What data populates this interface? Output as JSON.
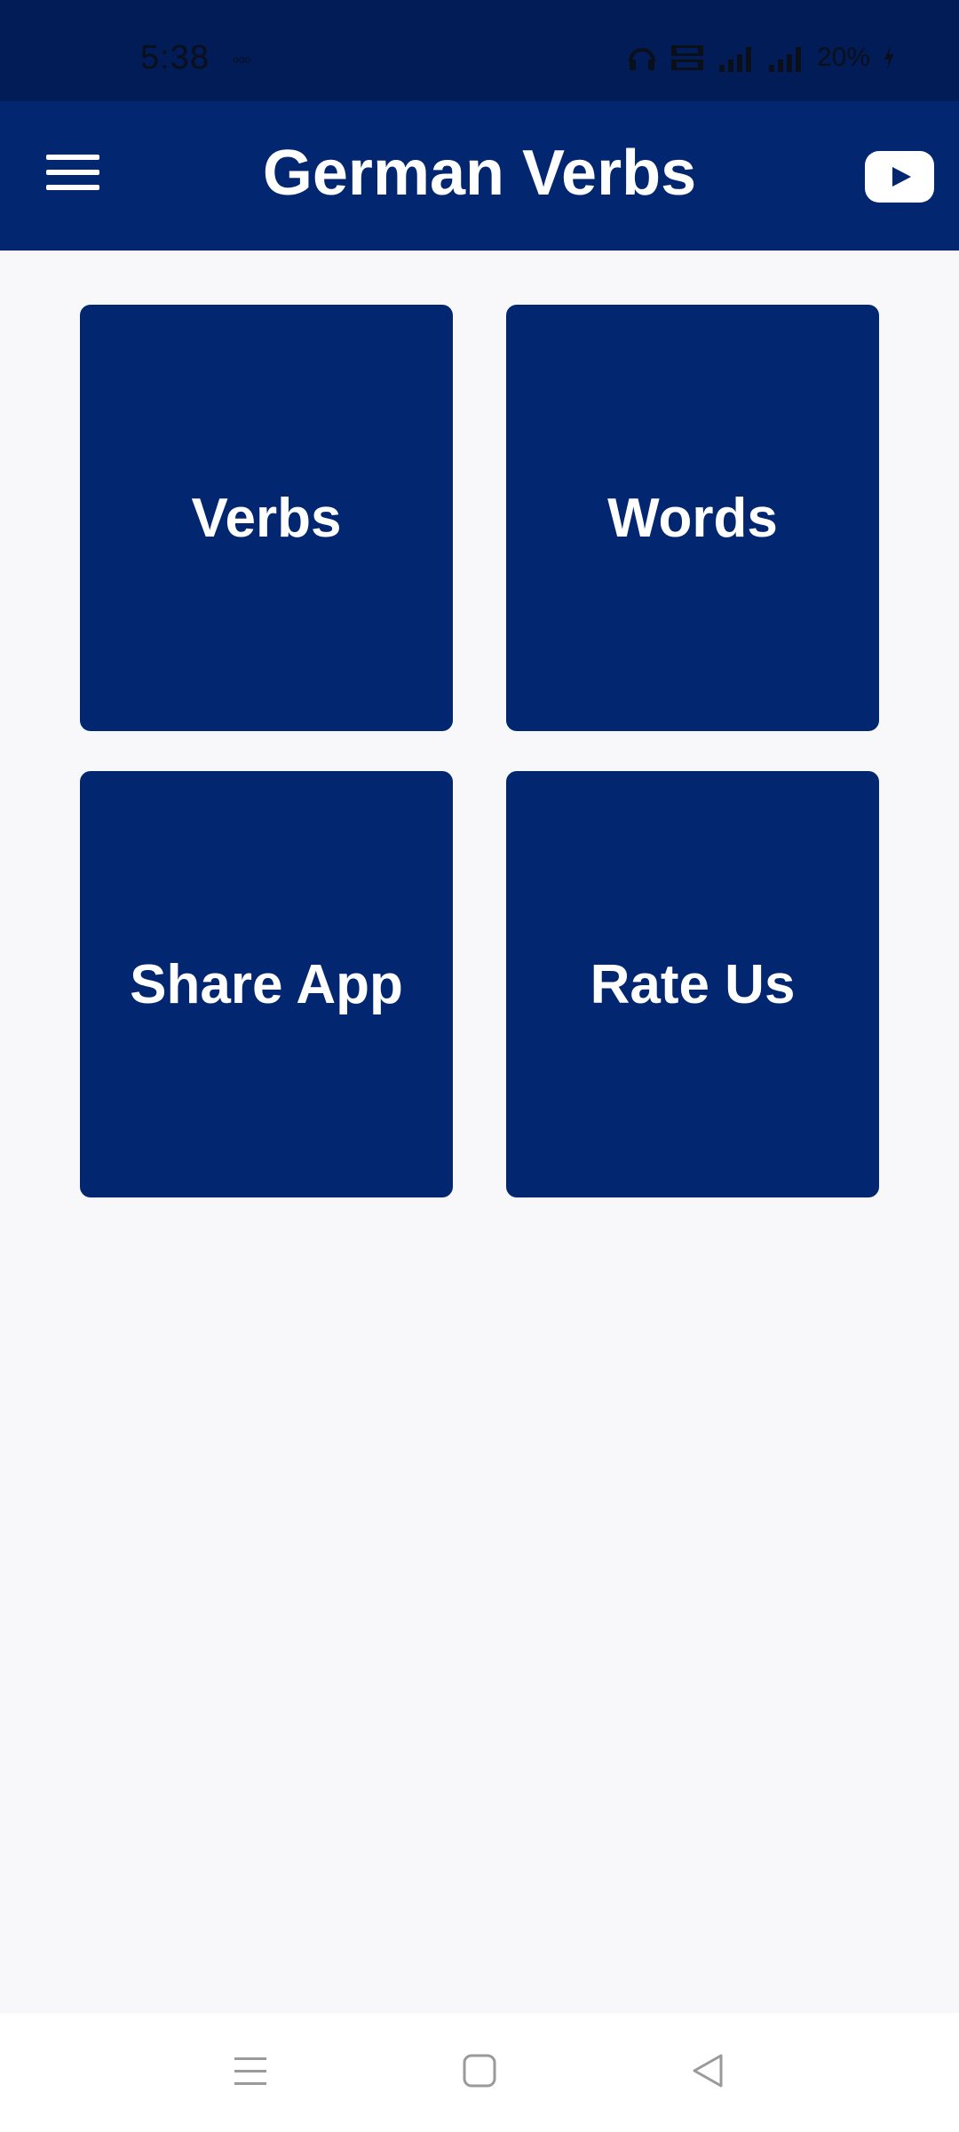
{
  "status_bar": {
    "time": "5:38",
    "dots": "ooo",
    "battery": "20%",
    "icons": [
      "headphones-icon",
      "volte-icon",
      "signal-icon",
      "signal-icon",
      "battery-charging-icon"
    ]
  },
  "app_bar": {
    "title": "German Verbs",
    "menu_icon": "hamburger-menu-icon",
    "youtube_icon": "youtube-icon"
  },
  "tiles": [
    {
      "label": "Verbs"
    },
    {
      "label": "Words"
    },
    {
      "label": "Share App"
    },
    {
      "label": "Rate Us"
    }
  ],
  "nav_bar": {
    "icons": [
      "recent-apps-icon",
      "home-icon",
      "back-icon"
    ]
  },
  "colors": {
    "status_bar": "#011c56",
    "primary": "#022670",
    "background": "#f8f7f9",
    "text_on_primary": "#ffffff"
  }
}
